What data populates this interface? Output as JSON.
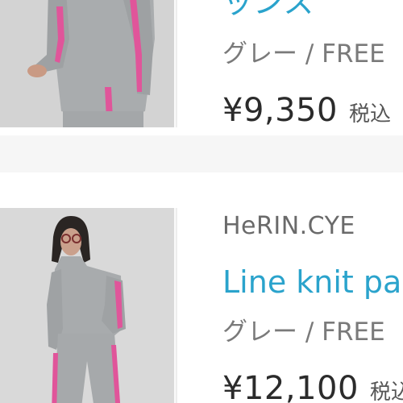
{
  "products": [
    {
      "title": "ッンス",
      "variant": "グレー / FREE",
      "price": "¥9,350",
      "tax_label": "税込"
    },
    {
      "brand": "HeRIN.CYE",
      "title": "Line knit pants",
      "variant": "グレー / FREE",
      "price": "¥12,100",
      "tax_label": "税込"
    }
  ],
  "colors": {
    "title": "#2aa3cc",
    "brand": "#6a6a6a",
    "variant": "#7a7a7a",
    "price": "#2b2b2b",
    "accent_stripe": "#e0559a",
    "knit_gray": "#a9acae"
  }
}
